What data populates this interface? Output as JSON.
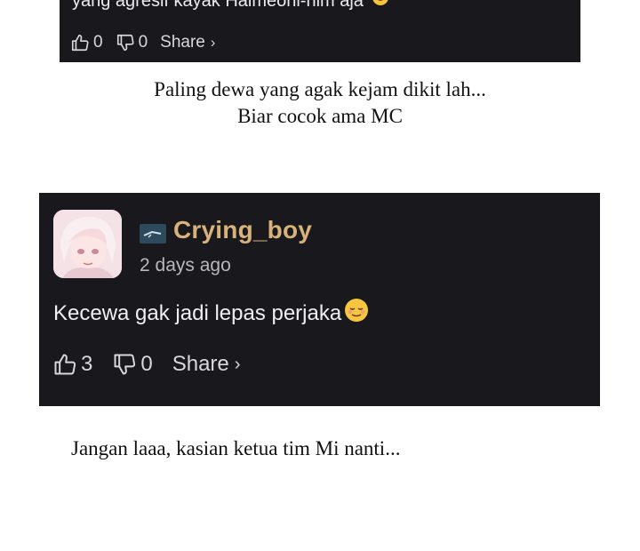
{
  "card_top": {
    "partial_text": "yang agresif kayak Halmeoni-nim aja",
    "likes": "0",
    "dislikes": "0",
    "share_label": "Share",
    "share_chevron": "›"
  },
  "narration_top": {
    "line1": "Paling dewa yang agak kejam dikit lah...",
    "line2": "Biar cocok ama MC"
  },
  "comment": {
    "username": "Crying_boy",
    "timestamp": "2 days ago",
    "text": "Kecewa gak jadi lepas perjaka",
    "likes": "3",
    "dislikes": "0",
    "share_label": "Share",
    "share_chevron": "›"
  },
  "narration_bottom": {
    "text": "Jangan laaa, kasian ketua tim Mi nanti..."
  },
  "colors": {
    "card_bg": "#19181d",
    "username": "#d8b27a",
    "timestamp": "#b9b7bd"
  }
}
